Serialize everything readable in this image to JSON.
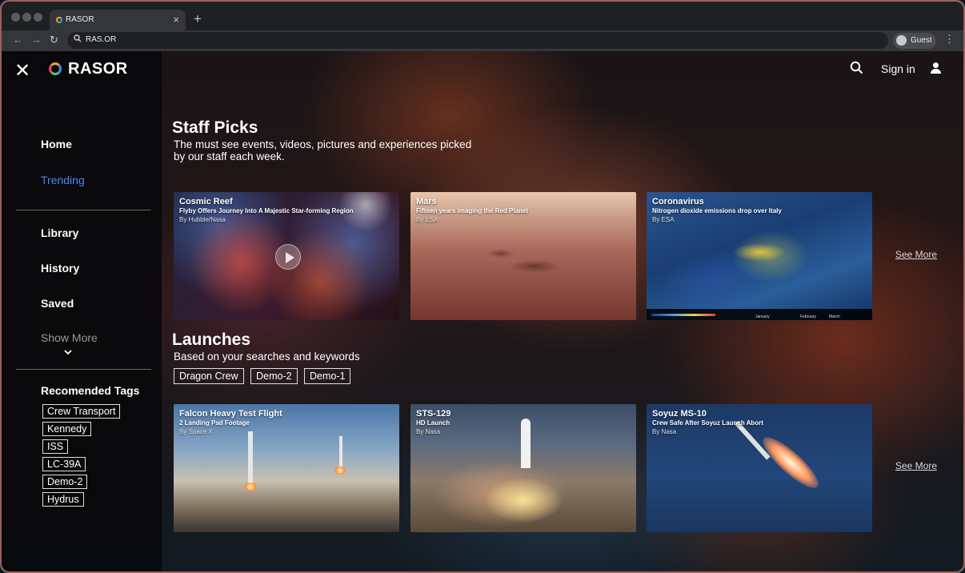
{
  "browser": {
    "tab_title": "RASOR",
    "url": "RAS.OR",
    "profile_label": "Guest",
    "new_tab_glyph": "+",
    "close_tab_glyph": "×"
  },
  "header": {
    "brand": "RASOR",
    "sign_in": "Sign in"
  },
  "sidebar": {
    "nav_top": [
      {
        "label": "Home"
      },
      {
        "label": "Trending"
      }
    ],
    "nav_bottom": [
      {
        "label": "Library"
      },
      {
        "label": "History"
      },
      {
        "label": "Saved"
      }
    ],
    "show_more": "Show More",
    "tags_heading": "Recomended Tags",
    "tags": [
      "Crew Transport",
      "Kennedy",
      "ISS",
      "LC-39A",
      "Demo-2",
      "Hydrus"
    ],
    "active_color": "#4a8cf0"
  },
  "staff_picks": {
    "title": "Staff Picks",
    "subtitle": "The must see events, videos, pictures and experiences picked by our staff each week.",
    "see_more": "See More",
    "cards": [
      {
        "title": "Cosmic Reef",
        "desc": "Flyby Offers Journey Into A Majestic Star-forming Region",
        "by": "By Hubble/Nasa",
        "has_video": true
      },
      {
        "title": "Mars",
        "desc": "Fifteen years imaging the Red Planet",
        "by": "By ESA"
      },
      {
        "title": "Coronavirus",
        "desc": "Nitrogen dioxide emissions drop over Italy",
        "by": "By ESA",
        "months": [
          "January",
          "February",
          "March"
        ]
      }
    ]
  },
  "launches": {
    "title": "Launches",
    "subtitle": "Based on your searches and keywords",
    "chips": [
      "Dragon Crew",
      "Demo-2",
      "Demo-1"
    ],
    "see_more": "See More",
    "cards": [
      {
        "title": "Falcon Heavy Test Flight",
        "desc": "2 Landing Pad Footage",
        "by": "By Space X"
      },
      {
        "title": "STS-129",
        "desc": "HD Launch",
        "by": "By Nasa"
      },
      {
        "title": "Soyuz MS-10",
        "desc": "Crew Safe After Soyuz Launch Abort",
        "by": "By Nasa"
      }
    ]
  },
  "icons": [
    "close-icon",
    "search-icon",
    "user-icon",
    "play-icon",
    "chevron-down-icon",
    "back-arrow-icon",
    "forward-arrow-icon",
    "reload-icon",
    "menu-kebab-icon"
  ]
}
